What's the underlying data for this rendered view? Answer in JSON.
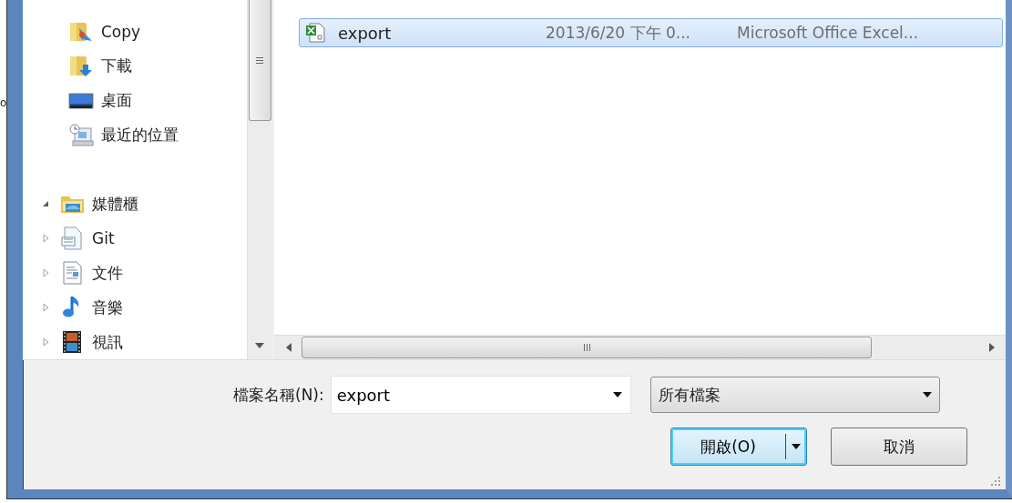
{
  "outside_text": "o",
  "navigation": {
    "items": [
      {
        "label": "Copy"
      },
      {
        "label": "下載"
      },
      {
        "label": "桌面"
      },
      {
        "label": "最近的位置"
      },
      {
        "label": "媒體櫃",
        "expanded": true,
        "children": [
          {
            "label": "Git",
            "expanded": false
          },
          {
            "label": "文件",
            "expanded": false
          },
          {
            "label": "音樂",
            "expanded": false
          },
          {
            "label": "視訊",
            "expanded": false
          }
        ]
      }
    ]
  },
  "files": [
    {
      "name": "export",
      "date": "2013/6/20 下午 0...",
      "type": "Microsoft Office Excel...",
      "selected": true
    }
  ],
  "file_name": {
    "label": "檔案名稱(N):",
    "value": "export"
  },
  "file_type": {
    "value": "所有檔案"
  },
  "buttons": [
    {
      "kind": "split",
      "label": "開啟(O)",
      "default": true
    },
    {
      "kind": "plain",
      "label": "取消",
      "default": false
    }
  ]
}
